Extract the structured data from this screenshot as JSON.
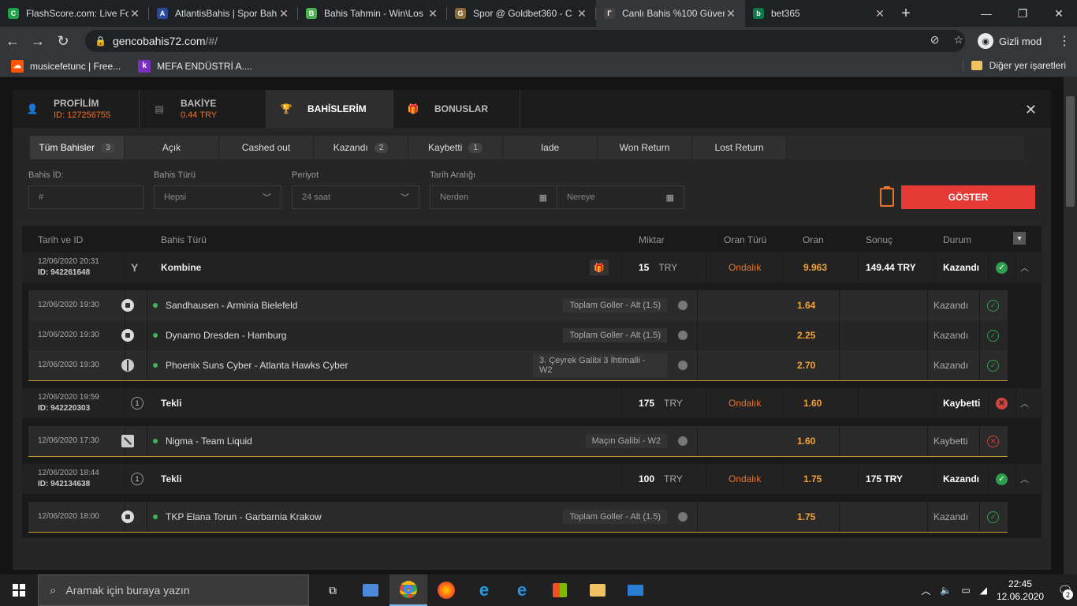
{
  "browser": {
    "tabs": [
      {
        "title": "FlashScore.com: Live Fo",
        "favicon_color": "#1ea24a",
        "glyph": "C"
      },
      {
        "title": "AtlantisBahis | Spor Bah",
        "favicon_color": "#2a4a9c",
        "glyph": "A"
      },
      {
        "title": "Bahis Tahmin - Win\\Los",
        "favicon_color": "#4caf50",
        "glyph": "B"
      },
      {
        "title": "Spor @ Goldbet360 - C",
        "favicon_color": "#8a6d3b",
        "glyph": "G"
      },
      {
        "title": "Canlı Bahis %100 Güven",
        "favicon_color": "#444444",
        "glyph": "Γ"
      },
      {
        "title": "bet365",
        "favicon_color": "#0f7a4a",
        "glyph": "b"
      }
    ],
    "active_tab": 4,
    "url_host": "gencobahis72.com",
    "url_path": "/#/",
    "incognito_label": "Gizli mod",
    "bookmarks": [
      {
        "label": "musicefetunc | Free...",
        "color": "#ff5500",
        "glyph": "☁"
      },
      {
        "label": "MEFA ENDÜSTRİ A....",
        "color": "#7b2fbf",
        "glyph": "k"
      }
    ],
    "other_bookmarks": "Diğer yer işaretleri"
  },
  "account_tabs": [
    {
      "label": "PROFİLİM",
      "sub": "ID: 127256755",
      "icon": "user-icon"
    },
    {
      "label": "BAKİYE",
      "sub": "0.44 TRY",
      "icon": "wallet-icon"
    },
    {
      "label": "BAHİSLERİM",
      "sub": "",
      "icon": "trophy-icon"
    },
    {
      "label": "BONUSLAR",
      "sub": "",
      "icon": "gift-icon"
    }
  ],
  "filter_tabs": [
    {
      "label": "Tüm Bahisler",
      "count": "3"
    },
    {
      "label": "Açık",
      "count": ""
    },
    {
      "label": "Cashed out",
      "count": ""
    },
    {
      "label": "Kazandı",
      "count": "2"
    },
    {
      "label": "Kaybetti",
      "count": "1"
    },
    {
      "label": "Iade",
      "count": ""
    },
    {
      "label": "Won Return",
      "count": ""
    },
    {
      "label": "Lost Return",
      "count": ""
    }
  ],
  "filters": {
    "bet_id_label": "Bahis İD:",
    "bet_id_placeholder": "#",
    "bet_type_label": "Bahis Türü",
    "bet_type_value": "Hepsi",
    "period_label": "Periyot",
    "period_value": "24 saat",
    "date_range_label": "Tarih Aralığı",
    "from_placeholder": "Nerden",
    "to_placeholder": "Nereye",
    "show_button": "GÖSTER"
  },
  "table_headers": {
    "date_id": "Tarih ve ID",
    "bet_type": "Bahis Türü",
    "amount": "Miktar",
    "odds_type": "Oran Türü",
    "odds": "Oran",
    "result": "Sonuç",
    "status": "Durum"
  },
  "bets": [
    {
      "date": "12/06/2020 20:31",
      "id": "ID: 942261648",
      "type": "Kombine",
      "amount": "15",
      "currency": "TRY",
      "odds_type": "Ondalık",
      "odds": "9.963",
      "result": "149.44 TRY",
      "status": "Kazandı",
      "outcome": "win",
      "selections": [
        {
          "date": "12/06/2020 19:30",
          "sport": "football",
          "match": "Sandhausen - Arminia Bielefeld",
          "market": "Toplam Goller - Alt (1.5)",
          "odds": "1.64",
          "status": "Kazandı",
          "outcome": "win"
        },
        {
          "date": "12/06/2020 19:30",
          "sport": "football",
          "match": "Dynamo Dresden - Hamburg",
          "market": "Toplam Goller - Alt (1.5)",
          "odds": "2.25",
          "status": "Kazandı",
          "outcome": "win"
        },
        {
          "date": "12/06/2020 19:30",
          "sport": "basketball",
          "match": "Phoenix Suns Cyber - Atlanta Hawks Cyber",
          "market": "3. Çeyrek Galibi 3 İhtimalli - W2",
          "odds": "2.70",
          "status": "Kazandı",
          "outcome": "win"
        }
      ]
    },
    {
      "date": "12/06/2020 19:59",
      "id": "ID: 942220303",
      "type": "Tekli",
      "amount": "175",
      "currency": "TRY",
      "odds_type": "Ondalık",
      "odds": "1.60",
      "result": "",
      "status": "Kaybetti",
      "outcome": "lose",
      "selections": [
        {
          "date": "12/06/2020 17:30",
          "sport": "dota",
          "match": "Nigma - Team Liquid",
          "market": "Maçın Galibi - W2",
          "odds": "1.60",
          "status": "Kaybetti",
          "outcome": "lose"
        }
      ]
    },
    {
      "date": "12/06/2020 18:44",
      "id": "ID: 942134638",
      "type": "Tekli",
      "amount": "100",
      "currency": "TRY",
      "odds_type": "Ondalık",
      "odds": "1.75",
      "result": "175 TRY",
      "status": "Kazandı",
      "outcome": "win",
      "selections": [
        {
          "date": "12/06/2020 18:00",
          "sport": "football",
          "match": "TKP Elana Torun - Garbarnia Krakow",
          "market": "Toplam Goller - Alt (1.5)",
          "odds": "1.75",
          "status": "Kazandı",
          "outcome": "win"
        }
      ]
    }
  ],
  "taskbar": {
    "search_placeholder": "Aramak için buraya yazın",
    "time": "22:45",
    "date": "12.06.2020",
    "notifications": "2"
  }
}
